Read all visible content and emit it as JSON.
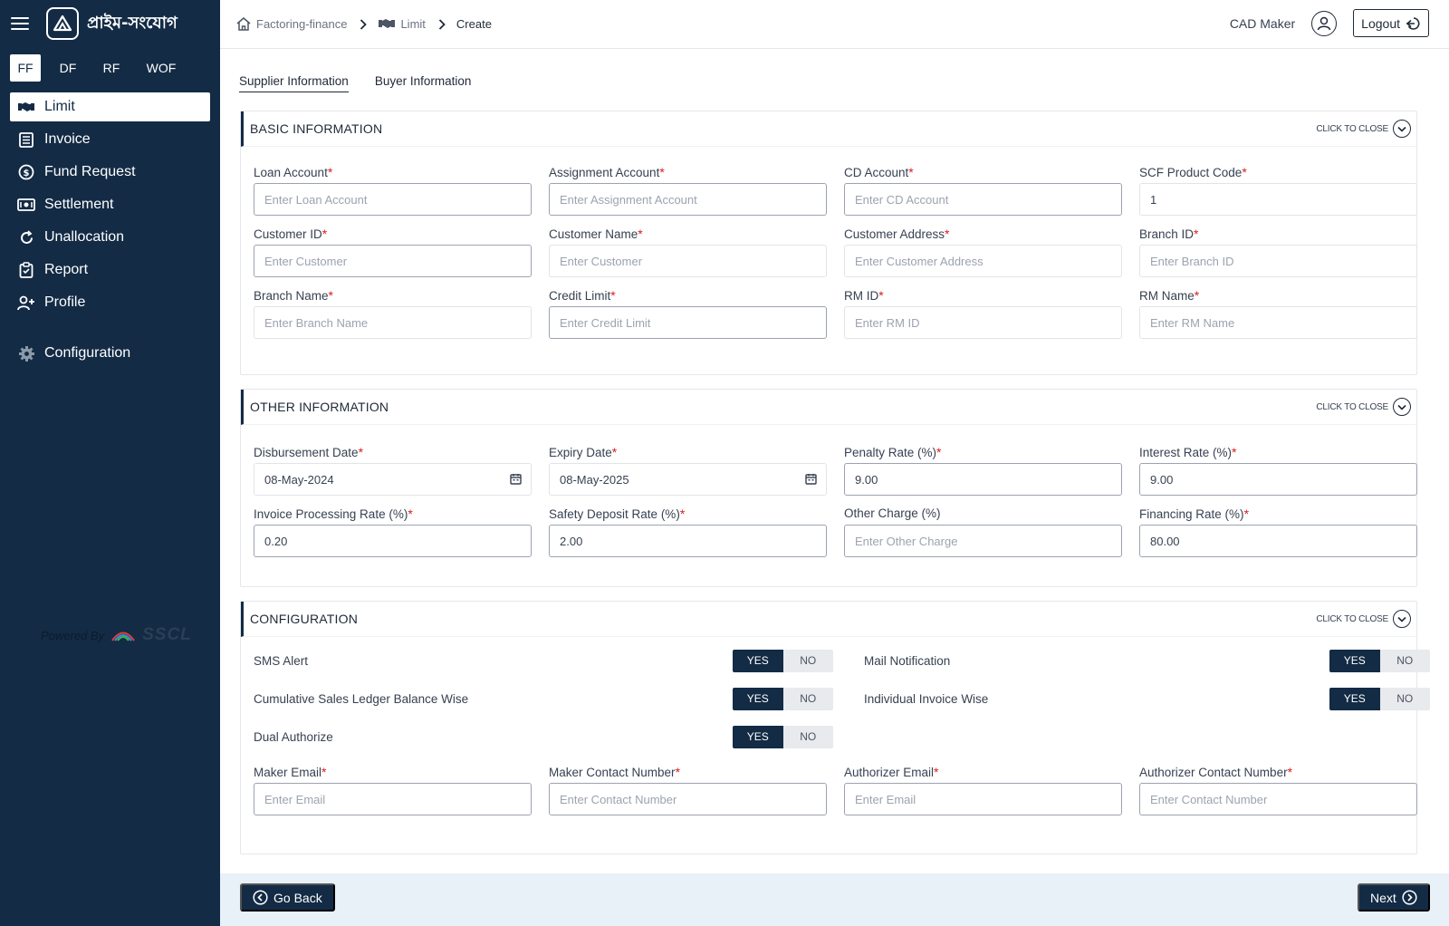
{
  "app": {
    "logo_text": "প্রাইম-সংযোগ",
    "product_tabs": [
      "FF",
      "DF",
      "RF",
      "WOF"
    ],
    "active_tab": "FF"
  },
  "nav": {
    "items": [
      {
        "label": "Limit",
        "icon": "handshake-icon",
        "active": true
      },
      {
        "label": "Invoice",
        "icon": "invoice-list-icon"
      },
      {
        "label": "Fund Request",
        "icon": "money-circle-icon"
      },
      {
        "label": "Settlement",
        "icon": "cash-icon"
      },
      {
        "label": "Unallocation",
        "icon": "refresh-icon"
      },
      {
        "label": "Report",
        "icon": "clipboard-icon"
      },
      {
        "label": "Profile",
        "icon": "user-plus-icon"
      }
    ],
    "config_label": "Configuration",
    "config_icon": "gear-icon"
  },
  "powered": {
    "label": "Powered By",
    "brand": "SSCL"
  },
  "breadcrumb": {
    "home": "Factoring-finance",
    "section": "Limit",
    "current": "Create"
  },
  "user": {
    "name": "CAD Maker",
    "logout": "Logout"
  },
  "tabs": [
    "Supplier Information",
    "Buyer Information"
  ],
  "collapse_label": "CLICK TO CLOSE",
  "basic": {
    "title": "BASIC INFORMATION",
    "fields": [
      {
        "label": "Loan Account",
        "placeholder": "Enter Loan Account",
        "value": ""
      },
      {
        "label": "Assignment Account",
        "placeholder": "Enter Assignment Account",
        "value": ""
      },
      {
        "label": "CD Account",
        "placeholder": "Enter CD Account",
        "value": ""
      },
      {
        "label": "SCF Product Code",
        "placeholder": "",
        "value": "1"
      },
      {
        "label": "Customer ID",
        "placeholder": "Enter Customer",
        "value": ""
      },
      {
        "label": "Customer Name",
        "placeholder": "Enter Customer",
        "value": ""
      },
      {
        "label": "Customer Address",
        "placeholder": "Enter Customer Address",
        "value": ""
      },
      {
        "label": "Branch ID",
        "placeholder": "Enter Branch ID",
        "value": ""
      },
      {
        "label": "Branch Name",
        "placeholder": "Enter Branch Name",
        "value": ""
      },
      {
        "label": "Credit Limit",
        "placeholder": "Enter Credit Limit",
        "value": ""
      },
      {
        "label": "RM ID",
        "placeholder": "Enter RM ID",
        "value": ""
      },
      {
        "label": "RM Name",
        "placeholder": "Enter RM Name",
        "value": ""
      }
    ]
  },
  "other": {
    "title": "OTHER INFORMATION",
    "fields": [
      {
        "label": "Disbursement Date",
        "placeholder": "",
        "value": "08-May-2024"
      },
      {
        "label": "Expiry Date",
        "placeholder": "",
        "value": "08-May-2025"
      },
      {
        "label": "Penalty Rate (%)",
        "placeholder": "",
        "value": "9.00"
      },
      {
        "label": "Interest Rate (%)",
        "placeholder": "",
        "value": "9.00"
      },
      {
        "label": "Invoice Processing Rate (%)",
        "placeholder": "",
        "value": "0.20"
      },
      {
        "label": "Safety Deposit Rate (%)",
        "placeholder": "",
        "value": "2.00"
      },
      {
        "label": "Other Charge (%)",
        "placeholder": "Enter Other Charge",
        "value": ""
      },
      {
        "label": "Financing Rate (%)",
        "placeholder": "",
        "value": "80.00"
      }
    ]
  },
  "config": {
    "title": "CONFIGURATION",
    "yes": "YES",
    "no": "NO",
    "toggles": [
      {
        "label": "SMS Alert",
        "value": "YES"
      },
      {
        "label": "Mail Notification",
        "value": "YES"
      },
      {
        "label": "Cumulative Sales Ledger Balance Wise",
        "value": "YES"
      },
      {
        "label": "Individual Invoice Wise",
        "value": "YES"
      },
      {
        "label": "Dual Authorize",
        "value": "YES"
      }
    ],
    "fields": [
      {
        "label": "Maker Email",
        "placeholder": "Enter Email",
        "value": ""
      },
      {
        "label": "Maker Contact Number",
        "placeholder": "Enter Contact Number",
        "value": ""
      },
      {
        "label": "Authorizer Email",
        "placeholder": "Enter Email",
        "value": ""
      },
      {
        "label": "Authorizer Contact Number",
        "placeholder": "Enter Contact Number",
        "value": ""
      }
    ]
  },
  "footer": {
    "back": "Go Back",
    "next": "Next"
  },
  "colors": {
    "primary": "#132b45",
    "required": "#d91c1c",
    "footer_bg": "#e8f0f8"
  }
}
